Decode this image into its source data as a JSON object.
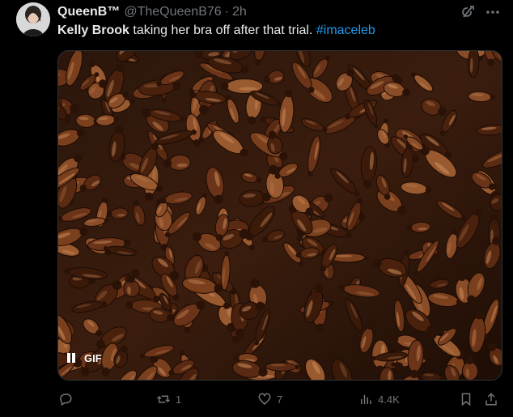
{
  "tweet": {
    "display_name": "QueenB™",
    "handle": "@TheQueenB76",
    "separator": "·",
    "time": "2h",
    "text_bold": "Kelly Brook",
    "text_rest": " taking her bra off after that trial. ",
    "hashtag": "#imaceleb",
    "media": {
      "badge": "GIF"
    },
    "actions": {
      "reply_count": "",
      "retweet_count": "1",
      "like_count": "7",
      "views_count": "4.4K"
    }
  },
  "colors": {
    "background": "#000000",
    "text": "#e7e9ea",
    "secondary": "#71767b",
    "link": "#1d9bf0"
  },
  "icons": {
    "grok": "grok-icon",
    "more": "more-icon",
    "reply": "reply-icon",
    "retweet": "retweet-icon",
    "like": "heart-icon",
    "views": "views-icon",
    "bookmark": "bookmark-icon",
    "share": "share-icon",
    "pause": "pause-icon"
  }
}
